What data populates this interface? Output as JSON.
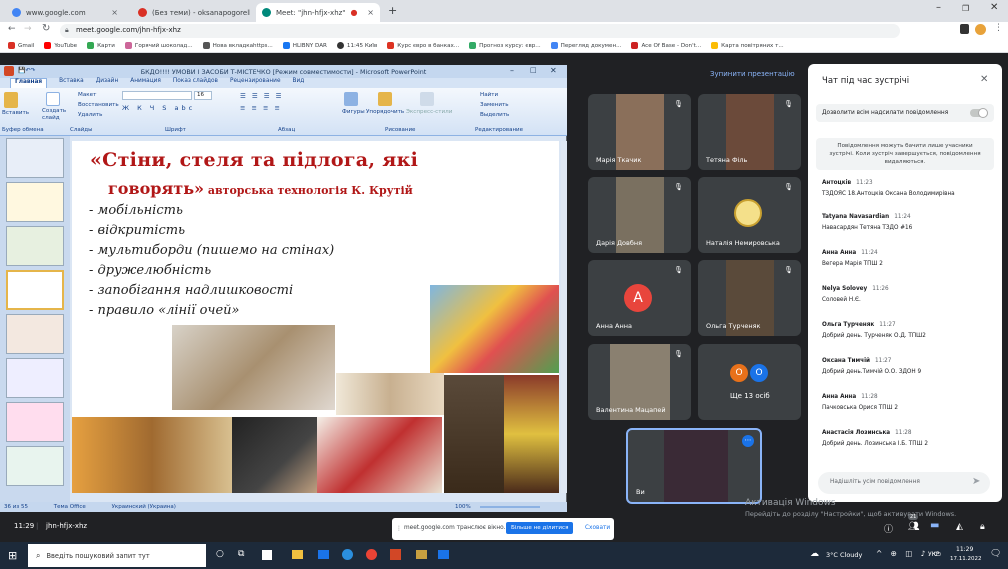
{
  "browser": {
    "tabs": [
      {
        "label": "www.google.com",
        "color": "#4285f4"
      },
      {
        "label": "(Без теми) - oksanapogorelko@...",
        "color": "#d93025"
      },
      {
        "label": "Meet: \"jhn-hfjx-xhz\"",
        "color": "#00897b"
      }
    ],
    "new_tab": "+",
    "url": "meet.google.com/jhn-hfjx-xhz",
    "bookmarks": [
      "Gmail",
      "YouTube",
      "Карти",
      "Горячий шоколад...",
      "Нова вкладкаhttps...",
      "HLIBNY DAR",
      "11:45 Київ",
      "Курс євро в банках...",
      "Прогноз курсу: євр...",
      "Перегляд докумен...",
      "Ace Of Base - Don't...",
      "Карта повітряних т..."
    ]
  },
  "ppt": {
    "title": "БКДО!!!!  УМОВИ І ЗАСОБИ  Т-МІСТЕЧКО [Режим совместимости] - Microsoft PowerPoint",
    "tabs": [
      "Главная",
      "Вставка",
      "Дизайн",
      "Анимация",
      "Показ слайдов",
      "Рецензирование",
      "Вид"
    ],
    "ribbon": {
      "paste": "Вставить",
      "create_slide": "Создать слайд",
      "layout": "Макет",
      "restore": "Восстановить",
      "delete": "Удалить",
      "groups": [
        "Буфер обмена",
        "Слайды",
        "Шрифт",
        "Абзац",
        "Рисование",
        "Редактирование"
      ],
      "figures": "Фигуры",
      "arrange": "Упорядочить",
      "express": "Экспресс-стили",
      "find": "Найти",
      "replace": "Заменить",
      "select": "Выделить",
      "font_size": "16"
    },
    "status": {
      "slide": "36 из 55",
      "theme": "Тема Office",
      "lang": "Украинский (Украина)",
      "zoom": "100%"
    },
    "slide": {
      "title_part1": "«Стіни, стеля та підлога, які",
      "title_part2": "говорять»",
      "title_part3": " авторська технологія К. Крутій",
      "bullets": [
        "мобільність",
        "відкритість",
        "мультиборди (пишемо на стінах)",
        "дружелюбність",
        "запобігання надлишковості",
        "правило «лінії очей»"
      ],
      "bullet_mark": "-"
    }
  },
  "meet": {
    "stop_present": "Зупинити презентацію",
    "participants": [
      {
        "name": "Марія Ткачик",
        "bg": "#8a6f5a"
      },
      {
        "name": "Тетяна Філь",
        "bg": "#6b4a3a"
      },
      {
        "name": "Дарія Довбня",
        "bg": "#7a7060"
      },
      {
        "name": "Наталія Немировська",
        "bg": "#3c4043"
      },
      {
        "name": "Анна Анна",
        "bg": "#3c4043",
        "avatar": "A"
      },
      {
        "name": "Ольга Турченяк",
        "bg": "#5a4a3a"
      },
      {
        "name": "Валентина Мацапей",
        "bg": "#8a8070"
      },
      {
        "name": "Ще 13 осіб",
        "bg": "#3c4043"
      }
    ],
    "self_label": "Ви",
    "more_avatars": [
      "О",
      "О"
    ],
    "meeting_code": "jhn-hfjx-xhz",
    "time": "11:29",
    "share_bar": {
      "text": "meet.google.com транслює вікно.",
      "stop": "Більше не ділитися",
      "hide": "Сховати"
    },
    "watermark1": "Активація Windows",
    "watermark2": "Перейдіть до розділу \"Настройки\", щоб активувати Windows.",
    "badge": "21"
  },
  "chat": {
    "title": "Чат під час зустрічі",
    "allow": "Дозволити всім надсилати повідомлення",
    "notice": "Повідомлення можуть бачити лише учасники зустрічі. Коли зустріч завершується, повідомлення видаляються.",
    "messages": [
      {
        "sender": "Антоцків",
        "time": "11:23",
        "text": "ТЗДОЯС 18.Антоцків Оксана Володимирівна"
      },
      {
        "sender": "Tatyana Navasardian",
        "time": "11:24",
        "text": "Навасардян Тетяна ТЗДО #16"
      },
      {
        "sender": "Анна Анна",
        "time": "11:24",
        "text": "Вегера  Марія ТПШ 2"
      },
      {
        "sender": "Nelya Solovey",
        "time": "11:26",
        "text": "Соловей Н.Є."
      },
      {
        "sender": "Ольга Турченяк",
        "time": "11:27",
        "text": "Добрий день. Турченяк О.Д. ТПШ2"
      },
      {
        "sender": "Оксана Тимчій",
        "time": "11:27",
        "text": "Добрий день.Тимчій О.О. ЗДОН 9"
      },
      {
        "sender": "Анна Анна",
        "time": "11:28",
        "text": "Пачковська Орися ТПШ 2"
      },
      {
        "sender": "Анастасія Лозинська",
        "time": "11:28",
        "text": "Добрий день. Лозинська І.Б. ТПШ 2"
      }
    ],
    "input_placeholder": "Надішліть усім повідомлення"
  },
  "taskbar": {
    "search": "Введіть пошуковий запит тут",
    "weather": "3°C  Cloudy",
    "lang": "УКР",
    "time": "11:29",
    "date": "17.11.2022"
  }
}
